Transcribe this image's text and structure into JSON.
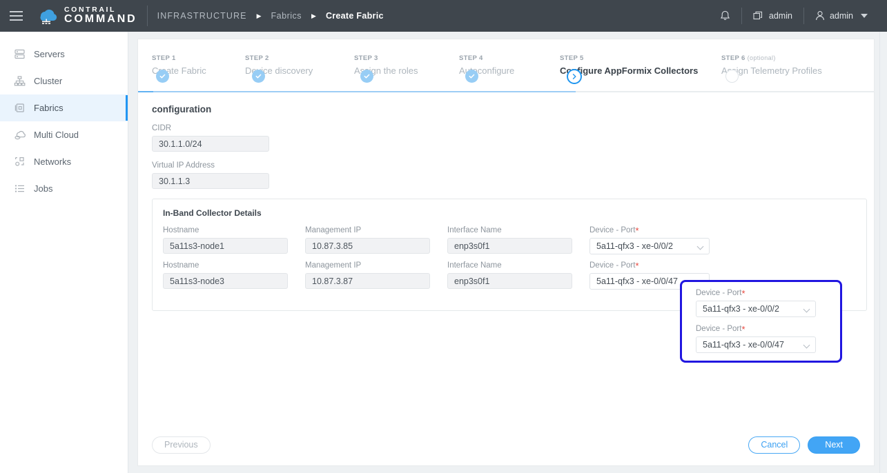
{
  "topbar": {
    "brand_line1": "CONTRAIL",
    "brand_line2": "COMMAND",
    "breadcrumb": [
      "INFRASTRUCTURE",
      "Fabrics",
      "Create Fabric"
    ],
    "notifications_icon": "bell-icon",
    "tenant_label": "admin",
    "user_label": "admin"
  },
  "sidebar": {
    "items": [
      {
        "label": "Servers",
        "icon": "server-icon",
        "active": false
      },
      {
        "label": "Cluster",
        "icon": "cluster-icon",
        "active": false
      },
      {
        "label": "Fabrics",
        "icon": "fabrics-icon",
        "active": true
      },
      {
        "label": "Multi Cloud",
        "icon": "multi-cloud-icon",
        "active": false
      },
      {
        "label": "Networks",
        "icon": "networks-icon",
        "active": false
      },
      {
        "label": "Jobs",
        "icon": "jobs-icon",
        "active": false
      }
    ]
  },
  "stepper": {
    "steps": [
      {
        "num": "STEP 1",
        "optional": "",
        "name": "Create Fabric",
        "state": "done"
      },
      {
        "num": "STEP 2",
        "optional": "",
        "name": "Device discovery",
        "state": "done"
      },
      {
        "num": "STEP 3",
        "optional": "",
        "name": "Assign the roles",
        "state": "done"
      },
      {
        "num": "STEP 4",
        "optional": "",
        "name": "Autoconfigure",
        "state": "done"
      },
      {
        "num": "STEP 5",
        "optional": "",
        "name": "Configure AppFormix Collectors",
        "state": "current"
      },
      {
        "num": "STEP 6",
        "optional": "(optional)",
        "name": "Assign Telemetry Profiles",
        "state": "todo"
      }
    ]
  },
  "form": {
    "section_title": "configuration",
    "cidr_label": "CIDR",
    "cidr_value": "30.1.1.0/24",
    "vip_label": "Virtual IP Address",
    "vip_value": "30.1.1.3"
  },
  "collector_panel": {
    "title": "In-Band Collector Details",
    "headers": {
      "hostname": "Hostname",
      "management_ip": "Management IP",
      "interface_name": "Interface Name",
      "device_port": "Device - Port",
      "required_mark": "*"
    },
    "rows": [
      {
        "hostname": "5a11s3-node1",
        "management_ip": "10.87.3.85",
        "interface_name": "enp3s0f1",
        "device_port": "5a11-qfx3 - xe-0/0/2"
      },
      {
        "hostname": "5a11s3-node3",
        "management_ip": "10.87.3.87",
        "interface_name": "enp3s0f1",
        "device_port": "5a11-qfx3 - xe-0/0/47"
      }
    ]
  },
  "footer": {
    "previous_label": "Previous",
    "cancel_label": "Cancel",
    "next_label": "Next"
  },
  "colors": {
    "topbar_bg": "#3f464d",
    "accent_blue": "#2196f3",
    "highlight_box": "#2116e0",
    "step_done": "#97cdf5",
    "required_red": "#e8453c"
  }
}
